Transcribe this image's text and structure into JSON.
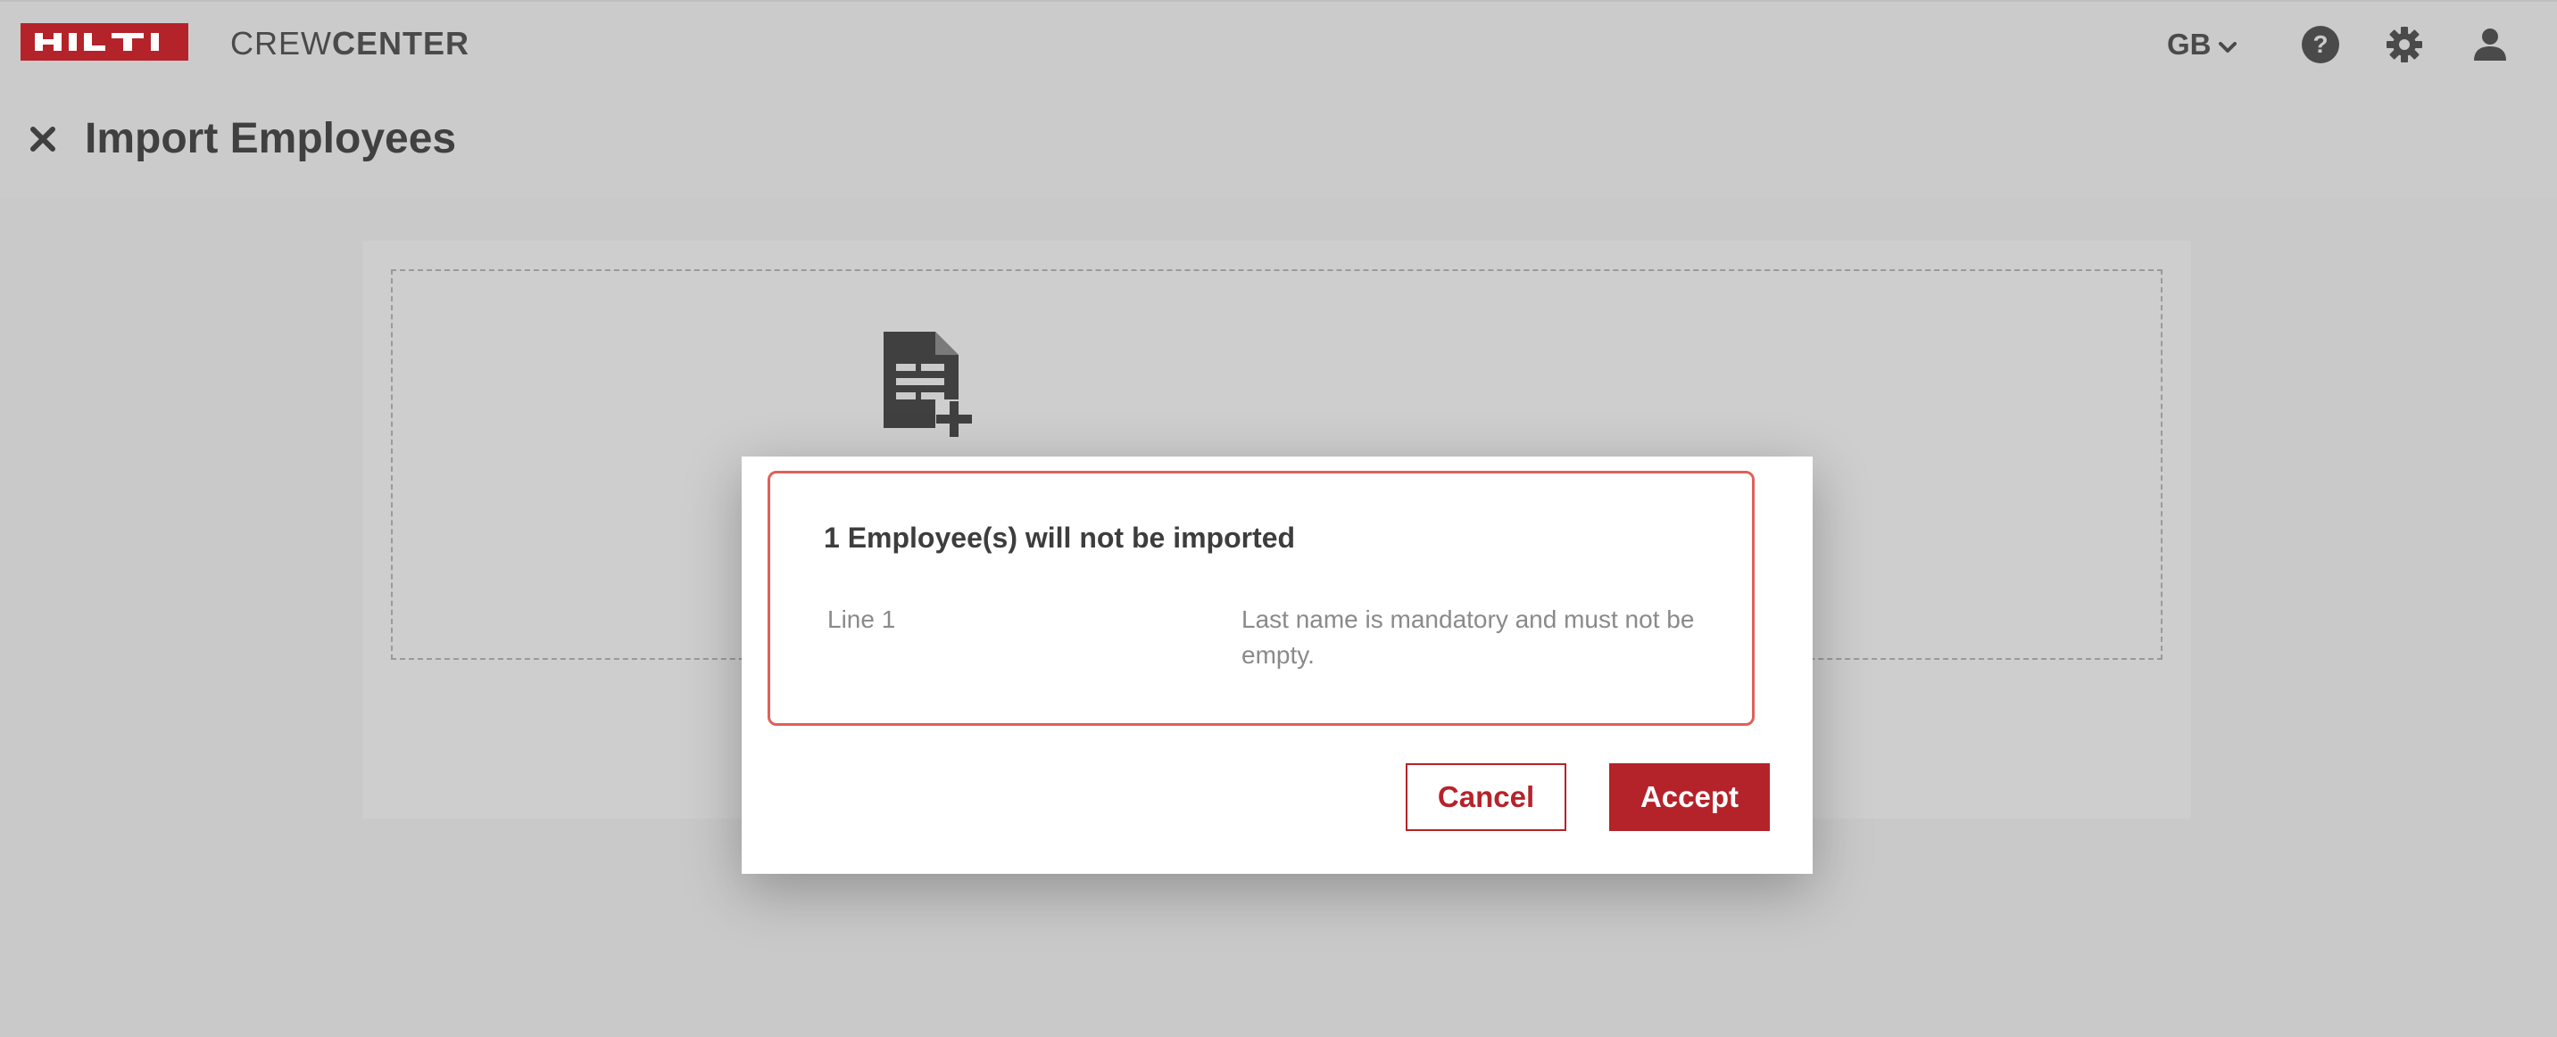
{
  "header": {
    "app_name_light": "CREW",
    "app_name_bold": "CENTER",
    "locale": "GB",
    "icons": [
      "hilti-logo",
      "chevron-down-icon",
      "help-icon",
      "gear-icon",
      "user-icon"
    ]
  },
  "page": {
    "title": "Import Employees",
    "close_icon": "close-icon"
  },
  "dropzone": {
    "icon": "file-add-icon"
  },
  "modal": {
    "title": "1 Employee(s) will not be imported",
    "errors": [
      {
        "line": "Line 1",
        "message": "Last name is mandatory and must not be empty."
      }
    ],
    "cancel_label": "Cancel",
    "accept_label": "Accept"
  },
  "colors": {
    "brand_red": "#b5232a",
    "error_border": "#e0605a",
    "overlay_gray": "#c9c9c9"
  }
}
